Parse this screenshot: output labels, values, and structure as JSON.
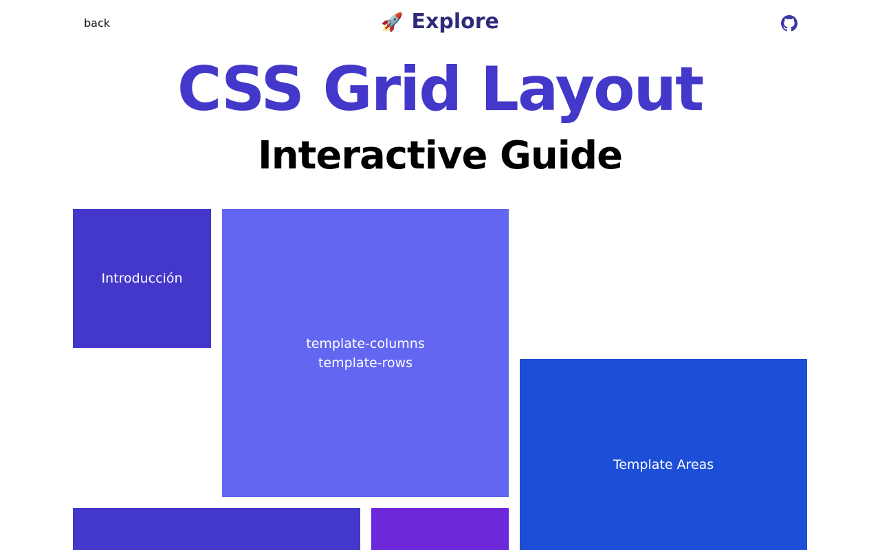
{
  "nav": {
    "back_label": "back",
    "brand_emoji": "🚀",
    "brand_label": "Explore",
    "github_icon": "github-icon"
  },
  "hero": {
    "title": "CSS Grid Layout",
    "subtitle": "Interactive Guide"
  },
  "tiles": {
    "intro": "Introducción",
    "template_line1": "template-columns",
    "template_line2": "template-rows",
    "areas": "Template Areas"
  },
  "colors": {
    "primary": "#4338ca",
    "indigo_light": "#6366f1",
    "blue": "#1d4ed8",
    "violet": "#6d28d9",
    "brand_text": "#2e2a7c"
  }
}
